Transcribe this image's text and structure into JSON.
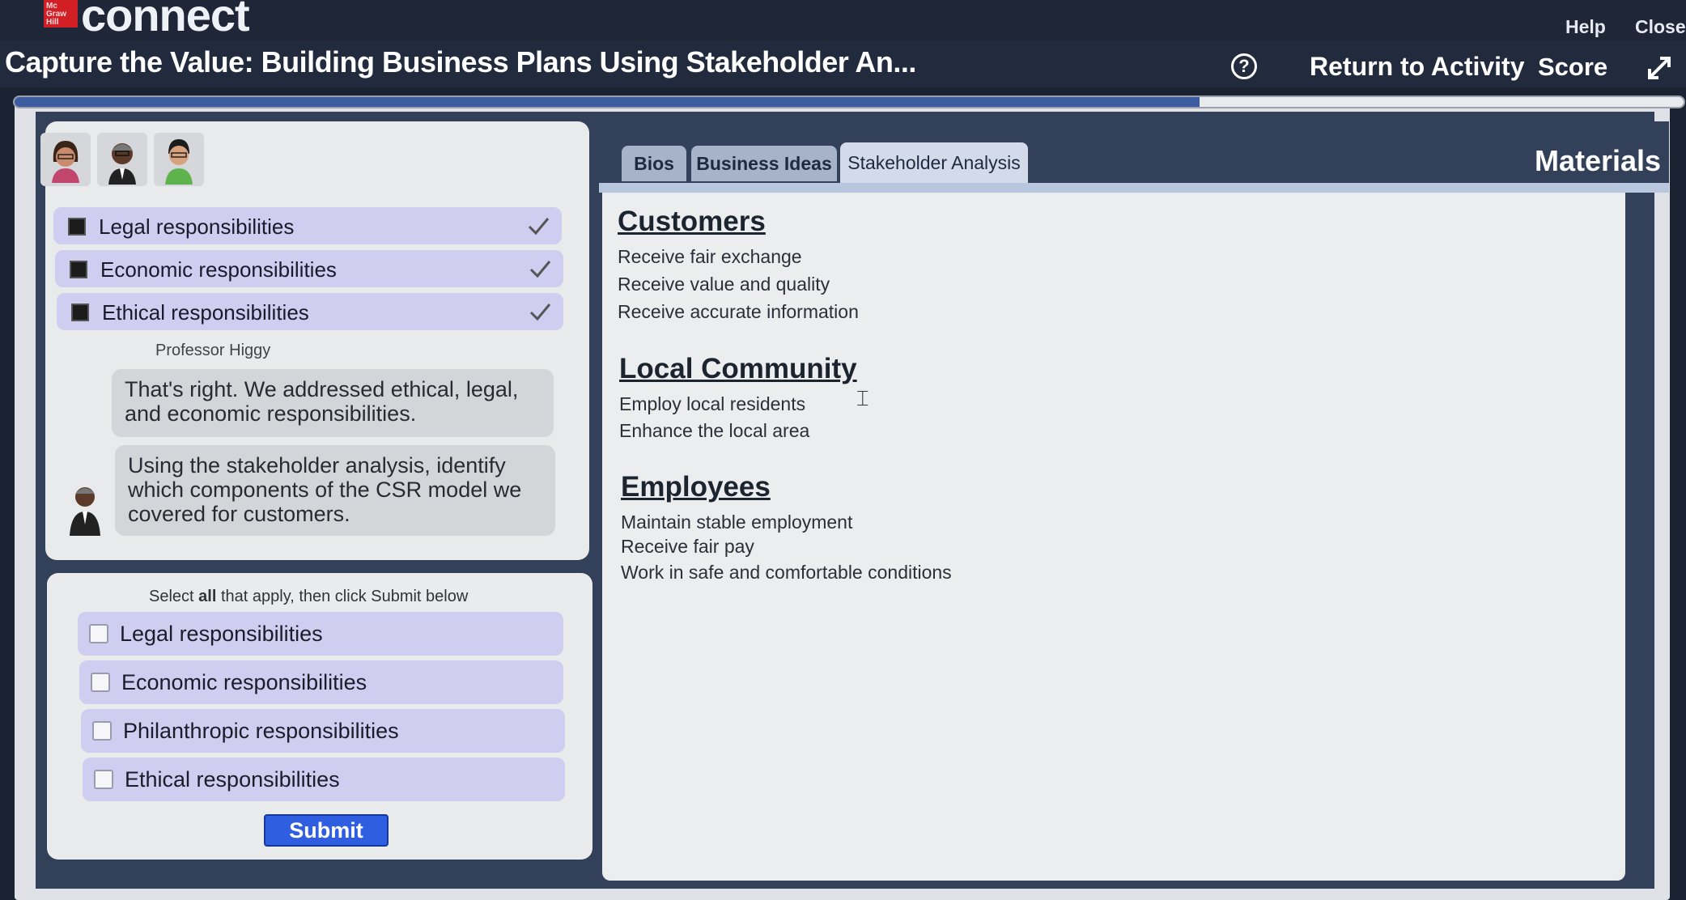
{
  "brand": {
    "logo_text": "Mc Graw Hill",
    "product": "connect"
  },
  "top_links": {
    "help": "Help",
    "close": "Close"
  },
  "title_bar": {
    "title": "Capture the Value: Building Business Plans Using Stakeholder An...",
    "help_icon_glyph": "?",
    "return_label": "Return to Activity",
    "score_label": "Score"
  },
  "progress": {
    "fraction": 0.71
  },
  "chat": {
    "selected_answers": [
      {
        "label": "Legal responsibilities"
      },
      {
        "label": "Economic responsibilities"
      },
      {
        "label": "Ethical responsibilities"
      }
    ],
    "speaker": "Professor Higgy",
    "messages": [
      "That's right. We addressed ethical, legal, and economic responsibilities.",
      "Using the stakeholder analysis, identify which components of the CSR model we covered for customers."
    ]
  },
  "question": {
    "instruction_pre": "Select ",
    "instruction_bold": "all",
    "instruction_post": " that apply, then click Submit below",
    "options": [
      {
        "label": "Legal responsibilities",
        "checked": false
      },
      {
        "label": "Economic responsibilities",
        "checked": false
      },
      {
        "label": "Philanthropic responsibilities",
        "checked": false
      },
      {
        "label": "Ethical responsibilities",
        "checked": false
      }
    ],
    "submit_label": "Submit"
  },
  "materials": {
    "heading": "Materials",
    "tabs": [
      {
        "label": "Bios",
        "active": false
      },
      {
        "label": "Business Ideas",
        "active": false
      },
      {
        "label": "Stakeholder Analysis",
        "active": true
      }
    ],
    "sections": [
      {
        "title": "Customers",
        "items": [
          "Receive fair exchange",
          "Receive value and quality",
          "Receive accurate information"
        ]
      },
      {
        "title": "Local Community",
        "items": [
          "Employ local residents",
          "Enhance the local area"
        ]
      },
      {
        "title": "Employees",
        "items": [
          "Maintain stable employment",
          "Receive fair pay",
          "Work in safe and comfortable conditions"
        ]
      }
    ]
  },
  "colors": {
    "brand_red": "#d21f26",
    "nav_dark": "#1e2638",
    "panel_navy": "#324159",
    "option_lavender": "#cfcdf0",
    "submit_blue": "#2f5fe0",
    "progress_blue": "#3d5c9f"
  },
  "icons": {
    "help": "question-circle-icon",
    "expand": "expand-arrows-icon",
    "check": "checkmark-icon",
    "cursor": "text-cursor-icon"
  }
}
